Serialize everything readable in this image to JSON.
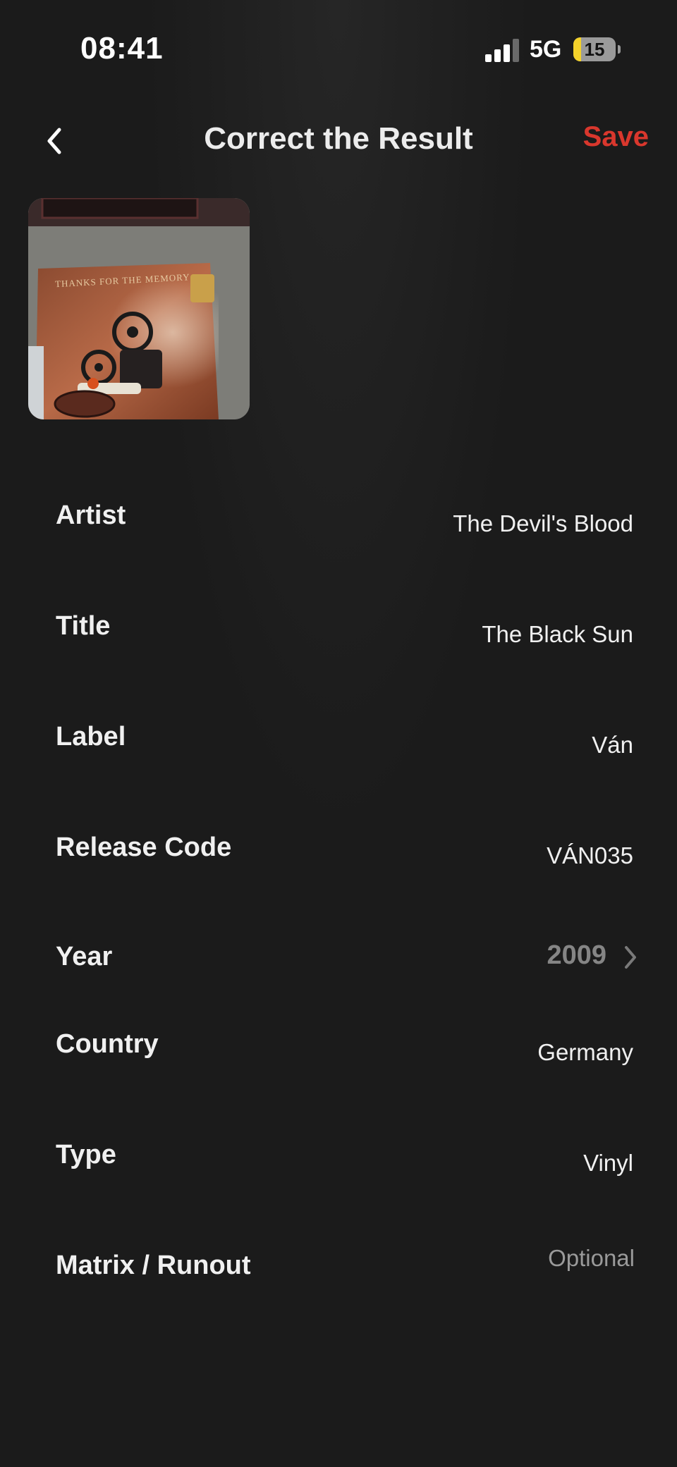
{
  "status_bar": {
    "time": "08:41",
    "network": "5G",
    "battery_level": "15",
    "battery_color": "#f4d22a"
  },
  "nav": {
    "back_icon": "chevron-left-icon",
    "title": "Correct the Result",
    "save_label": "Save",
    "accent_color": "#d9372d"
  },
  "cover": {
    "caption": "THANKS FOR THE MEMORY"
  },
  "form": {
    "artist": {
      "label": "Artist",
      "value": "The Devil's Blood"
    },
    "title": {
      "label": "Title",
      "value": "The Black Sun"
    },
    "record_label": {
      "label": "Label",
      "value": "Ván"
    },
    "release_code": {
      "label": "Release Code",
      "value": "VÁN035"
    },
    "year": {
      "label": "Year",
      "value": "2009",
      "icon": "chevron-right-icon"
    },
    "country": {
      "label": "Country",
      "value": "Germany"
    },
    "type": {
      "label": "Type",
      "value": "Vinyl"
    },
    "matrix": {
      "label": "Matrix / Runout",
      "placeholder": "Optional"
    }
  }
}
